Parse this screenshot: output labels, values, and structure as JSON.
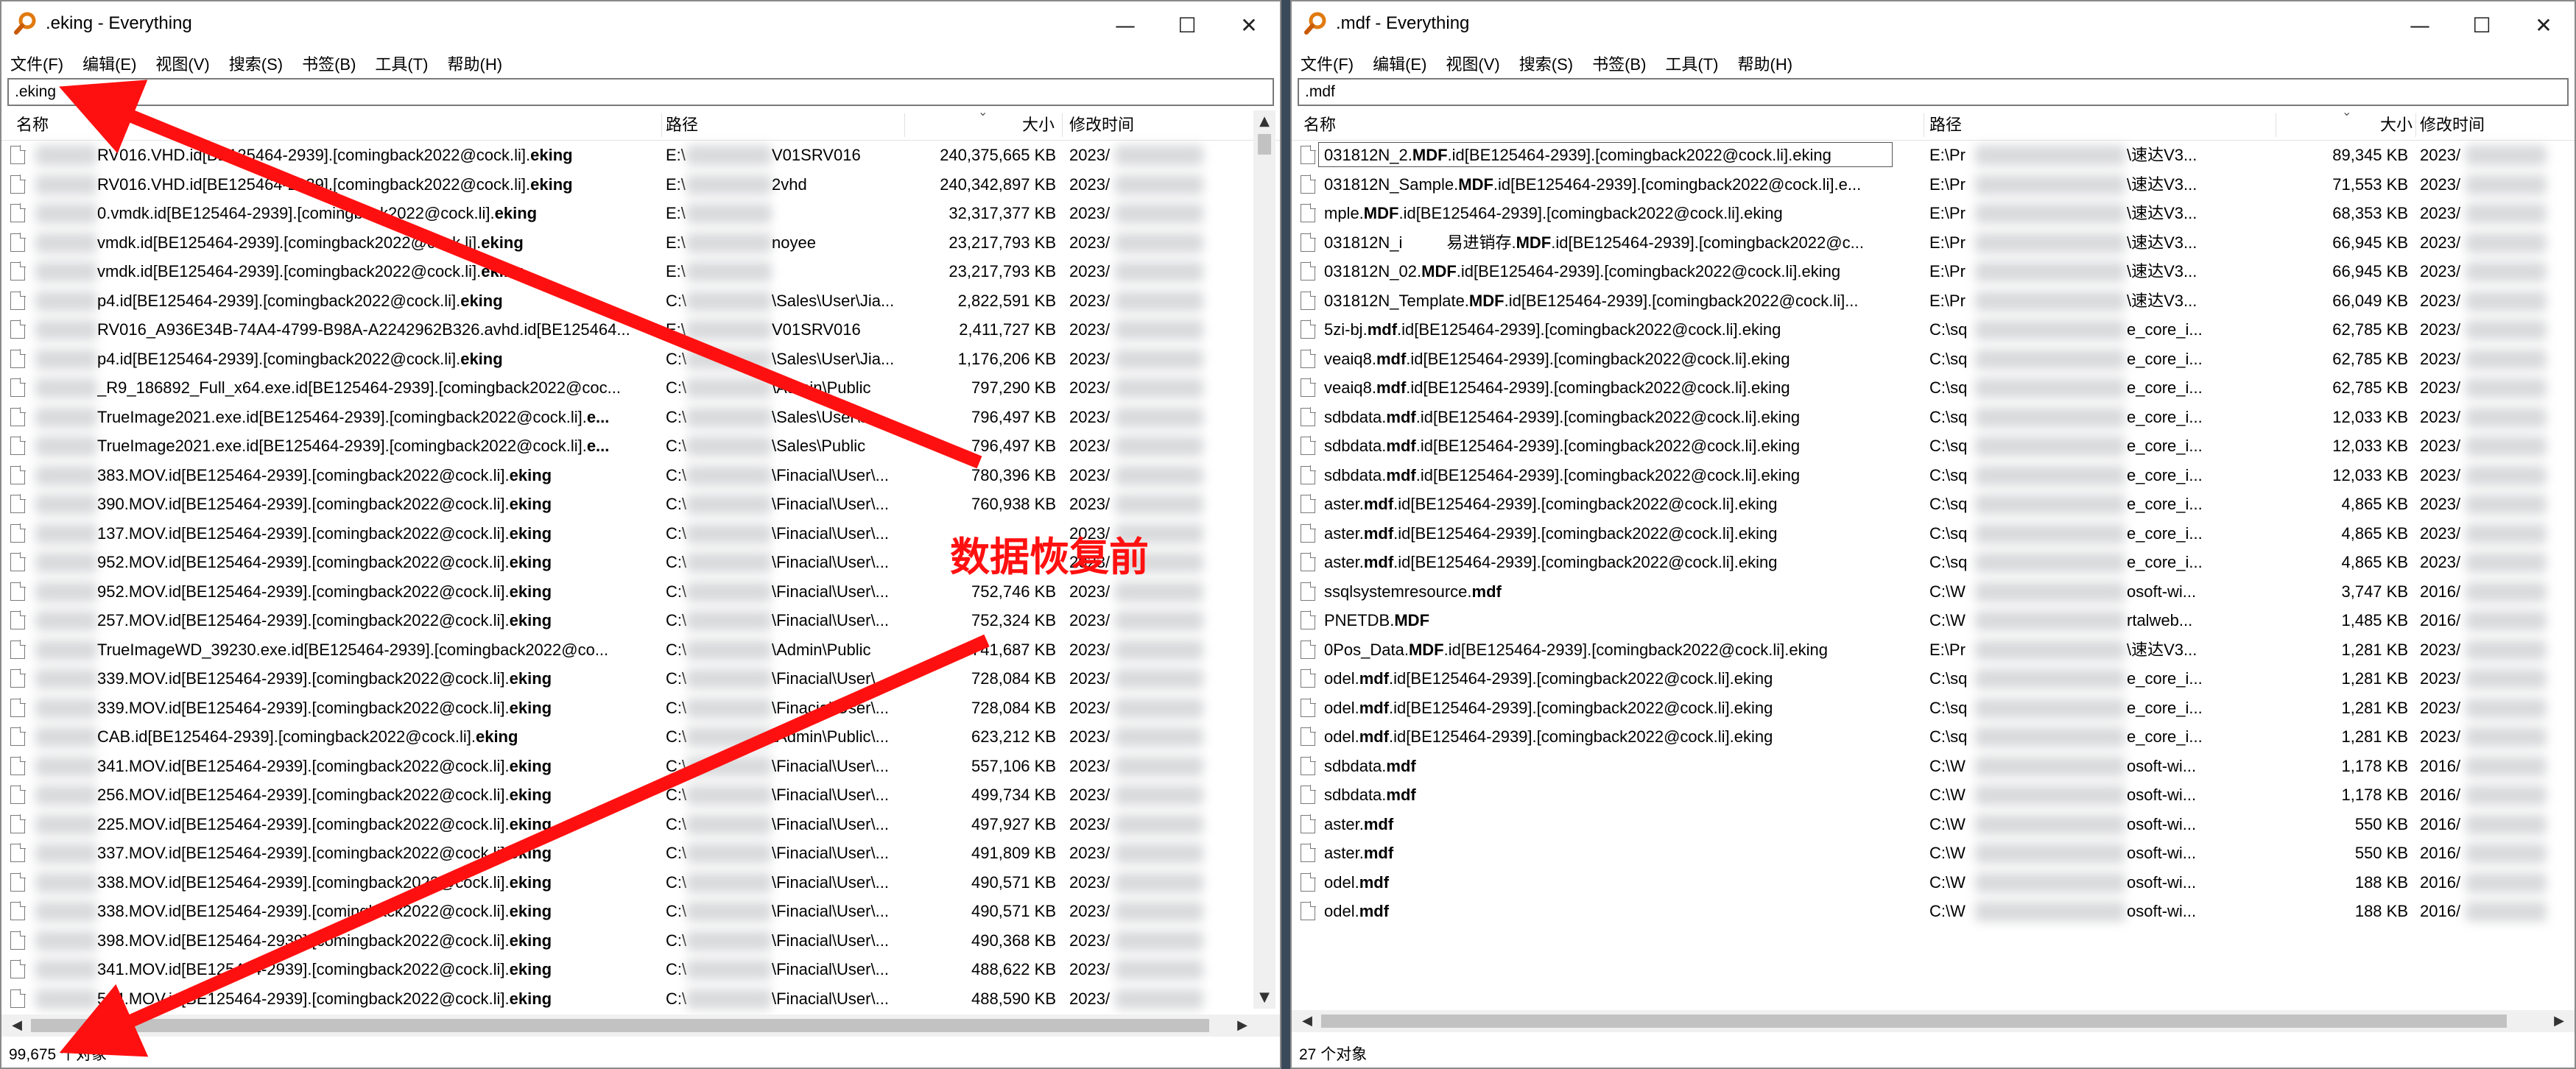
{
  "left": {
    "title": ".eking - Everything",
    "menu": [
      "文件(F)",
      "编辑(E)",
      "视图(V)",
      "搜索(S)",
      "书签(B)",
      "工具(T)",
      "帮助(H)"
    ],
    "search_value": ".eking",
    "columns": [
      "名称",
      "路径",
      "大小",
      "修改时间"
    ],
    "rows": [
      {
        "name": "RV016.VHD.id[BE125464-2939].[comingback2022@cock.li].",
        "ext": "eking",
        "path": "E:\\",
        "path2": "V01SRV016",
        "size": "240,375,665 KB",
        "date": "2023/"
      },
      {
        "name": "RV016.VHD.id[BE125464-2939].[comingback2022@cock.li].",
        "ext": "eking",
        "path": "E:\\",
        "path2": "2vhd",
        "size": "240,342,897 KB",
        "date": "2023/"
      },
      {
        "name": "0.vmdk.id[BE125464-2939].[comingback2022@cock.li].",
        "ext": "eking",
        "path": "E:\\",
        "path2": "",
        "size": "32,317,377 KB",
        "date": "2023/"
      },
      {
        "name": "vmdk.id[BE125464-2939].[comingback2022@cock.li].",
        "ext": "eking",
        "path": "E:\\",
        "path2": "noyee",
        "size": "23,217,793 KB",
        "date": "2023/"
      },
      {
        "name": "vmdk.id[BE125464-2939].[comingback2022@cock.li].",
        "ext": "eking",
        "path": "E:\\",
        "path2": "",
        "size": "23,217,793 KB",
        "date": "2023/"
      },
      {
        "name": "p4.id[BE125464-2939].[comingback2022@cock.li].",
        "ext": "eking",
        "path": "C:\\",
        "path2": "\\Sales\\User\\Jia...",
        "size": "2,822,591 KB",
        "date": "2023/"
      },
      {
        "name": "RV016_A936E34B-74A4-4799-B98A-A2242962B326.avhd.id[BE125464...",
        "ext": "",
        "path": "E:\\",
        "path2": "V01SRV016",
        "size": "2,411,727 KB",
        "date": "2023/"
      },
      {
        "name": "p4.id[BE125464-2939].[comingback2022@cock.li].",
        "ext": "eking",
        "path": "C:\\",
        "path2": "\\Sales\\User\\Jia...",
        "size": "1,176,206 KB",
        "date": "2023/"
      },
      {
        "name": "_R9_186892_Full_x64.exe.id[BE125464-2939].[comingback2022@coc...",
        "ext": "",
        "path": "C:\\",
        "path2": "\\Admin\\Public",
        "size": "797,290 KB",
        "date": "2023/"
      },
      {
        "name": "TrueImage2021.exe.id[BE125464-2939].[comingback2022@cock.li].",
        "ext": "e...",
        "path": "C:\\",
        "path2": "\\Sales\\User\\Jia...",
        "size": "796,497 KB",
        "date": "2023/"
      },
      {
        "name": "TrueImage2021.exe.id[BE125464-2939].[comingback2022@cock.li].",
        "ext": "e...",
        "path": "C:\\",
        "path2": "\\Sales\\Public",
        "size": "796,497 KB",
        "date": "2023/"
      },
      {
        "name": "383.MOV.id[BE125464-2939].[comingback2022@cock.li].",
        "ext": "eking",
        "path": "C:\\",
        "path2": "\\Finacial\\User\\...",
        "size": "780,396 KB",
        "date": "2023/"
      },
      {
        "name": "390.MOV.id[BE125464-2939].[comingback2022@cock.li].",
        "ext": "eking",
        "path": "C:\\",
        "path2": "\\Finacial\\User\\...",
        "size": "760,938 KB",
        "date": "2023/"
      },
      {
        "name": "137.MOV.id[BE125464-2939].[comingback2022@cock.li].",
        "ext": "eking",
        "path": "C:\\",
        "path2": "\\Finacial\\User\\...",
        "size": "",
        "date": "2023/"
      },
      {
        "name": "952.MOV.id[BE125464-2939].[comingback2022@cock.li].",
        "ext": "eking",
        "path": "C:\\",
        "path2": "\\Finacial\\User\\...",
        "size": "",
        "date": "2023/"
      },
      {
        "name": "952.MOV.id[BE125464-2939].[comingback2022@cock.li].",
        "ext": "eking",
        "path": "C:\\",
        "path2": "\\Finacial\\User\\...",
        "size": "752,746 KB",
        "date": "2023/"
      },
      {
        "name": "257.MOV.id[BE125464-2939].[comingback2022@cock.li].",
        "ext": "eking",
        "path": "C:\\",
        "path2": "\\Finacial\\User\\...",
        "size": "752,324 KB",
        "date": "2023/"
      },
      {
        "name": "TrueImageWD_39230.exe.id[BE125464-2939].[comingback2022@co...",
        "ext": "",
        "path": "C:\\",
        "path2": "\\Admin\\Public",
        "size": "741,687 KB",
        "date": "2023/"
      },
      {
        "name": "339.MOV.id[BE125464-2939].[comingback2022@cock.li].",
        "ext": "eking",
        "path": "C:\\",
        "path2": "\\Finacial\\User\\...",
        "size": "728,084 KB",
        "date": "2023/"
      },
      {
        "name": "339.MOV.id[BE125464-2939].[comingback2022@cock.li].",
        "ext": "eking",
        "path": "C:\\",
        "path2": "\\Finacial\\User\\...",
        "size": "728,084 KB",
        "date": "2023/"
      },
      {
        "name": "CAB.id[BE125464-2939].[comingback2022@cock.li].",
        "ext": "eking",
        "path": "C:\\",
        "path2": "\\Admin\\Public\\...",
        "size": "623,212 KB",
        "date": "2023/"
      },
      {
        "name": "341.MOV.id[BE125464-2939].[comingback2022@cock.li].",
        "ext": "eking",
        "path": "C:\\",
        "path2": "\\Finacial\\User\\...",
        "size": "557,106 KB",
        "date": "2023/"
      },
      {
        "name": "256.MOV.id[BE125464-2939].[comingback2022@cock.li].",
        "ext": "eking",
        "path": "C:\\",
        "path2": "\\Finacial\\User\\...",
        "size": "499,734 KB",
        "date": "2023/"
      },
      {
        "name": "225.MOV.id[BE125464-2939].[comingback2022@cock.li].",
        "ext": "eking",
        "path": "C:\\",
        "path2": "\\Finacial\\User\\...",
        "size": "497,927 KB",
        "date": "2023/"
      },
      {
        "name": "337.MOV.id[BE125464-2939].[comingback2022@cock.li].",
        "ext": "eking",
        "path": "C:\\",
        "path2": "\\Finacial\\User\\...",
        "size": "491,809 KB",
        "date": "2023/"
      },
      {
        "name": "338.MOV.id[BE125464-2939].[comingback2022@cock.li].",
        "ext": "eking",
        "path": "C:\\",
        "path2": "\\Finacial\\User\\...",
        "size": "490,571 KB",
        "date": "2023/"
      },
      {
        "name": "338.MOV.id[BE125464-2939].[comingback2022@cock.li].",
        "ext": "eking",
        "path": "C:\\",
        "path2": "\\Finacial\\User\\...",
        "size": "490,571 KB",
        "date": "2023/"
      },
      {
        "name": "398.MOV.id[BE125464-2939].[comingback2022@cock.li].",
        "ext": "eking",
        "path": "C:\\",
        "path2": "\\Finacial\\User\\...",
        "size": "490,368 KB",
        "date": "2023/"
      },
      {
        "name": "341.MOV.id[BE125464-2939].[comingback2022@cock.li].",
        "ext": "eking",
        "path": "C:\\",
        "path2": "\\Finacial\\User\\...",
        "size": "488,622 KB",
        "date": "2023/"
      },
      {
        "name": "524.MOV.id[BE125464-2939].[comingback2022@cock.li].",
        "ext": "eking",
        "path": "C:\\",
        "path2": "\\Finacial\\User\\...",
        "size": "488,590 KB",
        "date": "2023/"
      }
    ],
    "status": "99,675 个对象"
  },
  "right": {
    "title": ".mdf - Everything",
    "menu": [
      "文件(F)",
      "编辑(E)",
      "视图(V)",
      "搜索(S)",
      "书签(B)",
      "工具(T)",
      "帮助(H)"
    ],
    "search_value": ".mdf",
    "columns": [
      "名称",
      "路径",
      "大小",
      "修改时间"
    ],
    "rows": [
      {
        "pre": "031812N_2.",
        "bold": "MDF",
        "post": ".id[BE125464-2939].[comingback2022@cock.li].eking",
        "path": "E:\\Pr",
        "path2": "\\速达V3...",
        "size": "89,345 KB",
        "date": "2023/"
      },
      {
        "pre": "031812N_Sample.",
        "bold": "MDF",
        "post": ".id[BE125464-2939].[comingback2022@cock.li].e...",
        "path": "E:\\Pr",
        "path2": "\\速达V3...",
        "size": "71,553 KB",
        "date": "2023/"
      },
      {
        "pre": "mple.",
        "bold": "MDF",
        "post": ".id[BE125464-2939].[comingback2022@cock.li].eking",
        "path": "E:\\Pr",
        "path2": "\\速达V3...",
        "size": "68,353 KB",
        "date": "2023/"
      },
      {
        "pre": "031812N_i",
        "bold": "MDF",
        "post": ".id[BE125464-2939].[comingback2022@c...",
        "path": "E:\\Pr",
        "path2": "\\速达V3...",
        "size": "66,945 KB",
        "date": "2023/",
        "pre2": "易进销存."
      },
      {
        "pre": "031812N_02.",
        "bold": "MDF",
        "post": ".id[BE125464-2939].[comingback2022@cock.li].eking",
        "path": "E:\\Pr",
        "path2": "\\速达V3...",
        "size": "66,945 KB",
        "date": "2023/"
      },
      {
        "pre": "031812N_Template.",
        "bold": "MDF",
        "post": ".id[BE125464-2939].[comingback2022@cock.li]...",
        "path": "E:\\Pr",
        "path2": "\\速达V3...",
        "size": "66,049 KB",
        "date": "2023/"
      },
      {
        "pre": "5zi-bj.",
        "bold": "mdf",
        "post": ".id[BE125464-2939].[comingback2022@cock.li].eking",
        "path": "C:\\sq",
        "path2": "e_core_i...",
        "size": "62,785 KB",
        "date": "2023/"
      },
      {
        "pre": "veaiq8.",
        "bold": "mdf",
        "post": ".id[BE125464-2939].[comingback2022@cock.li].eking",
        "path": "C:\\sq",
        "path2": "e_core_i...",
        "size": "62,785 KB",
        "date": "2023/"
      },
      {
        "pre": "veaiq8.",
        "bold": "mdf",
        "post": ".id[BE125464-2939].[comingback2022@cock.li].eking",
        "path": "C:\\sq",
        "path2": "e_core_i...",
        "size": "62,785 KB",
        "date": "2023/"
      },
      {
        "pre": "sdbdata.",
        "bold": "mdf",
        "post": ".id[BE125464-2939].[comingback2022@cock.li].eking",
        "path": "C:\\sq",
        "path2": "e_core_i...",
        "size": "12,033 KB",
        "date": "2023/"
      },
      {
        "pre": "sdbdata.",
        "bold": "mdf",
        "post": ".id[BE125464-2939].[comingback2022@cock.li].eking",
        "path": "C:\\sq",
        "path2": "e_core_i...",
        "size": "12,033 KB",
        "date": "2023/"
      },
      {
        "pre": "sdbdata.",
        "bold": "mdf",
        "post": ".id[BE125464-2939].[comingback2022@cock.li].eking",
        "path": "C:\\sq",
        "path2": "e_core_i...",
        "size": "12,033 KB",
        "date": "2023/"
      },
      {
        "pre": "aster.",
        "bold": "mdf",
        "post": ".id[BE125464-2939].[comingback2022@cock.li].eking",
        "path": "C:\\sq",
        "path2": "e_core_i...",
        "size": "4,865 KB",
        "date": "2023/"
      },
      {
        "pre": "aster.",
        "bold": "mdf",
        "post": ".id[BE125464-2939].[comingback2022@cock.li].eking",
        "path": "C:\\sq",
        "path2": "e_core_i...",
        "size": "4,865 KB",
        "date": "2023/"
      },
      {
        "pre": "aster.",
        "bold": "mdf",
        "post": ".id[BE125464-2939].[comingback2022@cock.li].eking",
        "path": "C:\\sq",
        "path2": "e_core_i...",
        "size": "4,865 KB",
        "date": "2023/"
      },
      {
        "pre": "ssqlsystemresource.",
        "bold": "mdf",
        "post": "",
        "path": "C:\\W",
        "path2": "osoft-wi...",
        "size": "3,747 KB",
        "date": "2016/"
      },
      {
        "pre": "PNETDB.",
        "bold": "MDF",
        "post": "",
        "path": "C:\\W",
        "path2": "rtalweb...",
        "size": "1,485 KB",
        "date": "2016/"
      },
      {
        "pre": "0Pos_Data.",
        "bold": "MDF",
        "post": ".id[BE125464-2939].[comingback2022@cock.li].eking",
        "path": "E:\\Pr",
        "path2": "\\速达V3...",
        "size": "1,281 KB",
        "date": "2023/"
      },
      {
        "pre": "odel.",
        "bold": "mdf",
        "post": ".id[BE125464-2939].[comingback2022@cock.li].eking",
        "path": "C:\\sq",
        "path2": "e_core_i...",
        "size": "1,281 KB",
        "date": "2023/"
      },
      {
        "pre": "odel.",
        "bold": "mdf",
        "post": ".id[BE125464-2939].[comingback2022@cock.li].eking",
        "path": "C:\\sq",
        "path2": "e_core_i...",
        "size": "1,281 KB",
        "date": "2023/"
      },
      {
        "pre": "odel.",
        "bold": "mdf",
        "post": ".id[BE125464-2939].[comingback2022@cock.li].eking",
        "path": "C:\\sq",
        "path2": "e_core_i...",
        "size": "1,281 KB",
        "date": "2023/"
      },
      {
        "pre": "sdbdata.",
        "bold": "mdf",
        "post": "",
        "path": "C:\\W",
        "path2": "osoft-wi...",
        "size": "1,178 KB",
        "date": "2016/"
      },
      {
        "pre": "sdbdata.",
        "bold": "mdf",
        "post": "",
        "path": "C:\\W",
        "path2": "osoft-wi...",
        "size": "1,178 KB",
        "date": "2016/"
      },
      {
        "pre": "aster.",
        "bold": "mdf",
        "post": "",
        "path": "C:\\W",
        "path2": "osoft-wi...",
        "size": "550 KB",
        "date": "2016/"
      },
      {
        "pre": "aster.",
        "bold": "mdf",
        "post": "",
        "path": "C:\\W",
        "path2": "osoft-wi...",
        "size": "550 KB",
        "date": "2016/"
      },
      {
        "pre": "odel.",
        "bold": "mdf",
        "post": "",
        "path": "C:\\W",
        "path2": "osoft-wi...",
        "size": "188 KB",
        "date": "2016/"
      },
      {
        "pre": "odel.",
        "bold": "mdf",
        "post": "",
        "path": "C:\\W",
        "path2": "osoft-wi...",
        "size": "188 KB",
        "date": "2016/"
      }
    ],
    "status": "27 个对象"
  },
  "annotation": {
    "label": "数据恢复前",
    "color": "#ff1010"
  },
  "icons": {
    "app": "everything-magnifier-icon",
    "file": "file-icon",
    "minimize": "minimize-icon",
    "maximize": "maximize-icon",
    "close": "close-icon"
  }
}
